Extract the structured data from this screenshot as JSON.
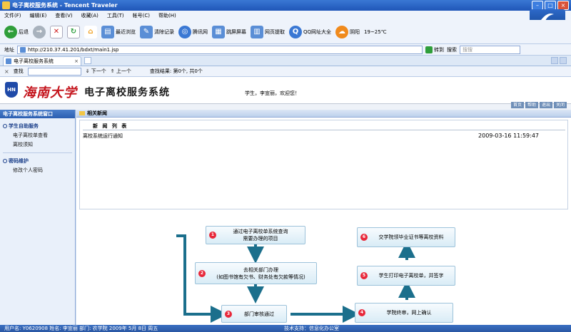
{
  "window": {
    "title": "电子离校服务系统 - Tencent Traveler"
  },
  "menu": [
    "文件(F)",
    "编辑(E)",
    "查看(V)",
    "收藏(A)",
    "工具(T)",
    "帐号(C)",
    "帮助(H)"
  ],
  "toolbar": {
    "back": "后退",
    "recent": "最近浏览",
    "clear": "清除记录",
    "tencent": "腾讯网",
    "split": "跳屏屏幕",
    "webpage": "网页提取",
    "qq": "QQ网址大全",
    "weather": "阴阳",
    "temp": "19~25℃"
  },
  "address": {
    "label": "地址",
    "url": "http://210.37.41.201/bdxt/main1.jsp",
    "go": "转到",
    "search_label": "搜索",
    "search_placeholder": "搜搜"
  },
  "tab": {
    "label": "电子离校服务系统"
  },
  "find": {
    "label": "查找",
    "next": "下一个",
    "prev": "上一个",
    "result": "查找结果: 第0个, 共0个"
  },
  "header": {
    "emblem": "HN",
    "university": "海南大学",
    "system": "电子离校服务系统",
    "welcome": "学生，李宣丽，欢迎您！"
  },
  "topnav": [
    "首页",
    "帮助",
    "退出",
    "关闭"
  ],
  "sidebar": {
    "title": "电子离校服务系统窗口",
    "groups": [
      {
        "label": "学生自助服务",
        "items": [
          "电子离校单查看",
          "离校须知"
        ]
      },
      {
        "label": "密码维护",
        "items": [
          "修改个人密码"
        ]
      }
    ]
  },
  "content": {
    "crumb": "相关新闻",
    "list_title": "新 闻 列 表",
    "news": [
      {
        "title": "离校系统运行通知",
        "date": "2009-03-16 11:59:47"
      }
    ]
  },
  "flow": {
    "steps": [
      {
        "num": "1",
        "text": "通过电子离校单系统查询\n需要办理的项目"
      },
      {
        "num": "2",
        "text": "去相关部门办理\n(如图书馆有欠书、财务处有欠款等情况)"
      },
      {
        "num": "3",
        "text": "部门审核通过"
      },
      {
        "num": "4",
        "text": "学院终审，网上确认"
      },
      {
        "num": "5",
        "text": "学生打印电子离校单，并签字"
      },
      {
        "num": "6",
        "text": "交学院领毕业证书等离校资料"
      }
    ]
  },
  "status": {
    "user": "用户名: Y0620908   姓名: 李宣丽   部门: 农学院     2009年 5月 8日 周五",
    "support": "技术支持：信息化办公室"
  },
  "colors": {
    "titlebar": "#1f56b8",
    "flow_box": "#d9ecf6",
    "arrow": "#1b6f8c",
    "step_num": "#e8283a",
    "university": "#c4141c"
  }
}
